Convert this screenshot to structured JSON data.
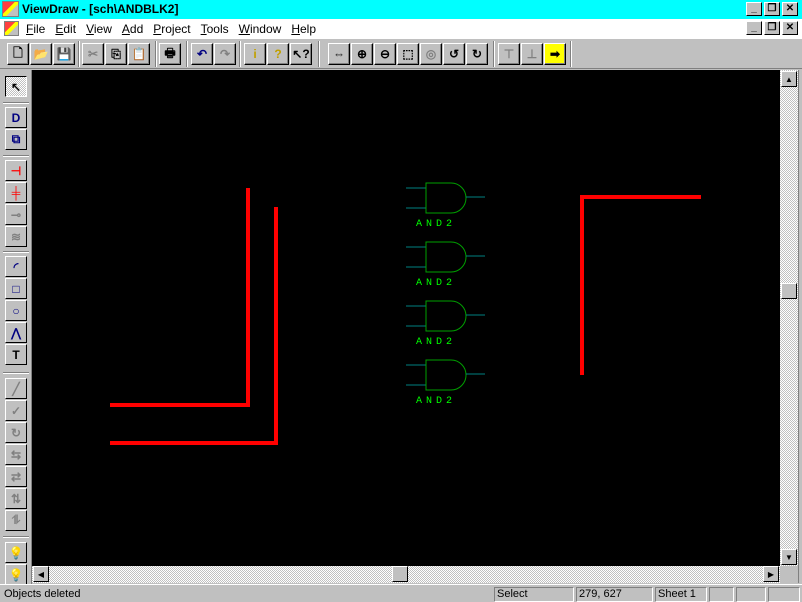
{
  "window": {
    "title": "ViewDraw - [sch\\ANDBLK2]",
    "controls": {
      "minimize": "_",
      "restore": "🗗",
      "close": "✕"
    }
  },
  "menubar": {
    "items": [
      {
        "label": "File",
        "accel": "F"
      },
      {
        "label": "Edit",
        "accel": "E"
      },
      {
        "label": "View",
        "accel": "V"
      },
      {
        "label": "Add",
        "accel": "A"
      },
      {
        "label": "Project",
        "accel": "P"
      },
      {
        "label": "Tools",
        "accel": "T"
      },
      {
        "label": "Window",
        "accel": "W"
      },
      {
        "label": "Help",
        "accel": "H"
      }
    ]
  },
  "toolbar": {
    "buttons": [
      {
        "name": "new-icon",
        "glyph": "🗋",
        "enabled": true
      },
      {
        "name": "open-icon",
        "glyph": "📂",
        "enabled": true
      },
      {
        "name": "save-icon",
        "glyph": "💾",
        "enabled": true
      },
      {
        "name": "cut-icon",
        "glyph": "✂",
        "enabled": false
      },
      {
        "name": "copy-icon",
        "glyph": "⎘",
        "enabled": true
      },
      {
        "name": "paste-icon",
        "glyph": "📋",
        "enabled": false
      },
      {
        "name": "print-icon",
        "glyph": "🖶",
        "enabled": true
      },
      {
        "name": "undo-icon",
        "glyph": "↶",
        "enabled": true
      },
      {
        "name": "redo-icon",
        "glyph": "↷",
        "enabled": false
      },
      {
        "name": "info-icon",
        "glyph": "i",
        "enabled": true
      },
      {
        "name": "help-icon",
        "glyph": "?",
        "enabled": true
      },
      {
        "name": "context-help-icon",
        "glyph": "↖?",
        "enabled": true
      },
      {
        "name": "zoom-fit-icon",
        "glyph": "⇔",
        "enabled": true
      },
      {
        "name": "zoom-in-icon",
        "glyph": "⊕",
        "enabled": true
      },
      {
        "name": "zoom-out-icon",
        "glyph": "⊖",
        "enabled": true
      },
      {
        "name": "zoom-box-icon",
        "glyph": "⬚",
        "enabled": true
      },
      {
        "name": "zoom-selection-icon",
        "glyph": "◎",
        "enabled": false
      },
      {
        "name": "push-into-icon",
        "glyph": "↺",
        "enabled": true
      },
      {
        "name": "pop-out-icon",
        "glyph": "↻",
        "enabled": true
      },
      {
        "name": "hierarchy-down-icon",
        "glyph": "⊤",
        "enabled": false
      },
      {
        "name": "hierarchy-up-icon",
        "glyph": "⊥",
        "enabled": false
      },
      {
        "name": "run-arrow-icon",
        "glyph": "➡",
        "enabled": true
      }
    ]
  },
  "lefttools": {
    "buttons": [
      {
        "name": "select-tool-icon",
        "glyph": "↖",
        "enabled": true,
        "pressed": true
      },
      {
        "name": "add-component-icon",
        "glyph": "D",
        "enabled": true
      },
      {
        "name": "component-browser-icon",
        "glyph": "⧉",
        "enabled": true
      },
      {
        "name": "add-net-icon",
        "glyph": "⊣",
        "enabled": true
      },
      {
        "name": "add-bus-icon",
        "glyph": "╪",
        "enabled": true
      },
      {
        "name": "add-bus-rip-icon",
        "glyph": "⊸",
        "enabled": false
      },
      {
        "name": "add-connector-icon",
        "glyph": "≋",
        "enabled": false
      },
      {
        "name": "add-arc-icon",
        "glyph": "◜",
        "enabled": true
      },
      {
        "name": "add-box-icon",
        "glyph": "□",
        "enabled": true
      },
      {
        "name": "add-circle-icon",
        "glyph": "○",
        "enabled": true
      },
      {
        "name": "add-line-icon",
        "glyph": "⋀",
        "enabled": true
      },
      {
        "name": "add-text-icon",
        "glyph": "T",
        "enabled": true
      },
      {
        "name": "pencil-icon",
        "glyph": "╱",
        "enabled": false
      },
      {
        "name": "check-icon",
        "glyph": "✓",
        "enabled": false
      },
      {
        "name": "rotate-icon",
        "glyph": "↻",
        "enabled": false
      },
      {
        "name": "flip-horizontal-icon",
        "glyph": "⇆",
        "enabled": false
      },
      {
        "name": "mirror-icon",
        "glyph": "⇄",
        "enabled": false
      },
      {
        "name": "flip-vertical-icon",
        "glyph": "⇅",
        "enabled": false
      },
      {
        "name": "flip-rotate-icon",
        "glyph": "⥮",
        "enabled": false
      },
      {
        "name": "bulb-on-icon",
        "glyph": "💡",
        "enabled": false
      },
      {
        "name": "bulb-off-icon",
        "glyph": "💡",
        "enabled": false
      }
    ]
  },
  "schematic": {
    "gates": [
      {
        "type": "AND2",
        "label": "AND2"
      },
      {
        "type": "AND2",
        "label": "AND2"
      },
      {
        "type": "AND2",
        "label": "AND2"
      },
      {
        "type": "AND2",
        "label": "AND2"
      }
    ],
    "colors": {
      "background": "#000000",
      "gate_body": "#00a000",
      "gate_pins": "#008080",
      "gate_label": "#00ff00",
      "wire": "#ff0000"
    }
  },
  "statusbar": {
    "message": "Objects deleted",
    "mode": "Select",
    "coordinates": "279, 627",
    "sheet": "Sheet 1",
    "extra1": "",
    "extra2": "",
    "extra3": ""
  }
}
